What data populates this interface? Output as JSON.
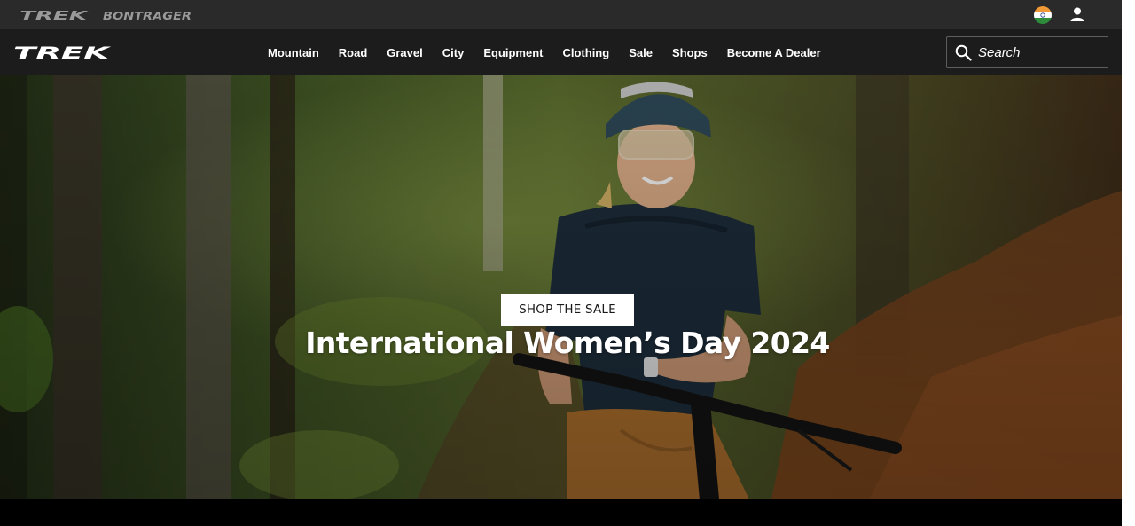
{
  "brand_bar": {
    "brands": [
      "TREK",
      "BONTRAGER"
    ],
    "country_flag_icon": "india-flag-icon",
    "account_icon": "user-icon"
  },
  "main_nav": {
    "logo": "TREK",
    "items": [
      "Mountain",
      "Road",
      "Gravel",
      "City",
      "Equipment",
      "Clothing",
      "Sale",
      "Shops",
      "Become A Dealer"
    ],
    "search": {
      "placeholder": "Search",
      "icon": "search-icon"
    }
  },
  "hero": {
    "title": "International Women’s Day 2024",
    "cta_label": "SHOP THE SALE"
  },
  "colors": {
    "brand_bar_bg": "#2a2a2a",
    "nav_bg": "#1c1c1c",
    "text": "#ffffff",
    "cta_bg": "#ffffff",
    "cta_text": "#1a1a1a"
  }
}
